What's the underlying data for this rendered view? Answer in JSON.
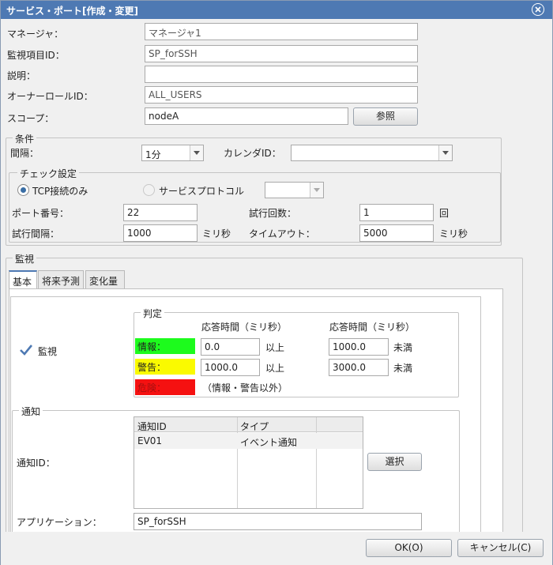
{
  "window": {
    "title": "サービス・ポート[作成・変更]"
  },
  "form": {
    "manager": {
      "label": "マネージャ：",
      "value": "マネージャ1"
    },
    "monitor_id": {
      "label": "監視項目ID：",
      "value": "SP_forSSH"
    },
    "description": {
      "label": "説明：",
      "value": ""
    },
    "owner_role": {
      "label": "オーナーロールID：",
      "value": "ALL_USERS"
    },
    "scope": {
      "label": "スコープ：",
      "value": "nodeA",
      "button": "参照"
    }
  },
  "conditions": {
    "legend": "条件",
    "interval": {
      "label": "間隔：",
      "value": "1分"
    },
    "calendar": {
      "label": "カレンダID：",
      "value": ""
    }
  },
  "check": {
    "legend": "チェック設定",
    "radio_tcp": {
      "label": "TCP接続のみ",
      "selected": true
    },
    "radio_service": {
      "label": "サービスプロトコル",
      "selected": false
    },
    "service_select": "",
    "port": {
      "label": "ポート番号：",
      "value": "22"
    },
    "retry_count": {
      "label": "試行回数：",
      "value": "1",
      "unit": "回"
    },
    "retry_interval": {
      "label": "試行間隔：",
      "value": "1000",
      "unit": "ミリ秒"
    },
    "timeout": {
      "label": "タイムアウト：",
      "value": "5000",
      "unit": "ミリ秒"
    }
  },
  "monitoring": {
    "legend": "監視",
    "tabs": [
      "基本",
      "将来予測",
      "変化量"
    ],
    "monitor_checkbox": {
      "label": "監視",
      "checked": true
    },
    "judgement": {
      "legend": "判定",
      "col1_header": "応答時間（ミリ秒）",
      "col2_header": "応答時間（ミリ秒）",
      "info": {
        "label": "情報：",
        "color": "#1dfb1d",
        "min": "0.0",
        "min_unit": "以上",
        "max": "1000.0",
        "max_unit": "未満"
      },
      "warning": {
        "label": "警告：",
        "color": "#fafa00",
        "min": "1000.0",
        "min_unit": "以上",
        "max": "3000.0",
        "max_unit": "未満"
      },
      "critical": {
        "label": "危険：",
        "color": "#f51111",
        "note": "（情報・警告以外）"
      }
    },
    "notification": {
      "legend": "通知",
      "notify_id_label": "通知ID：",
      "columns": [
        "通知ID",
        "タイプ"
      ],
      "rows": [
        {
          "id": "EV01",
          "type": "イベント通知"
        }
      ],
      "select_button": "選択",
      "application_label": "アプリケーション：",
      "application_value": "SP_forSSH"
    }
  },
  "footer": {
    "ok": "OK(O)",
    "cancel": "キャンセル(C)"
  },
  "colors": {
    "titlebar": "#4e79b3",
    "tab_accent": "#4e79b3"
  }
}
